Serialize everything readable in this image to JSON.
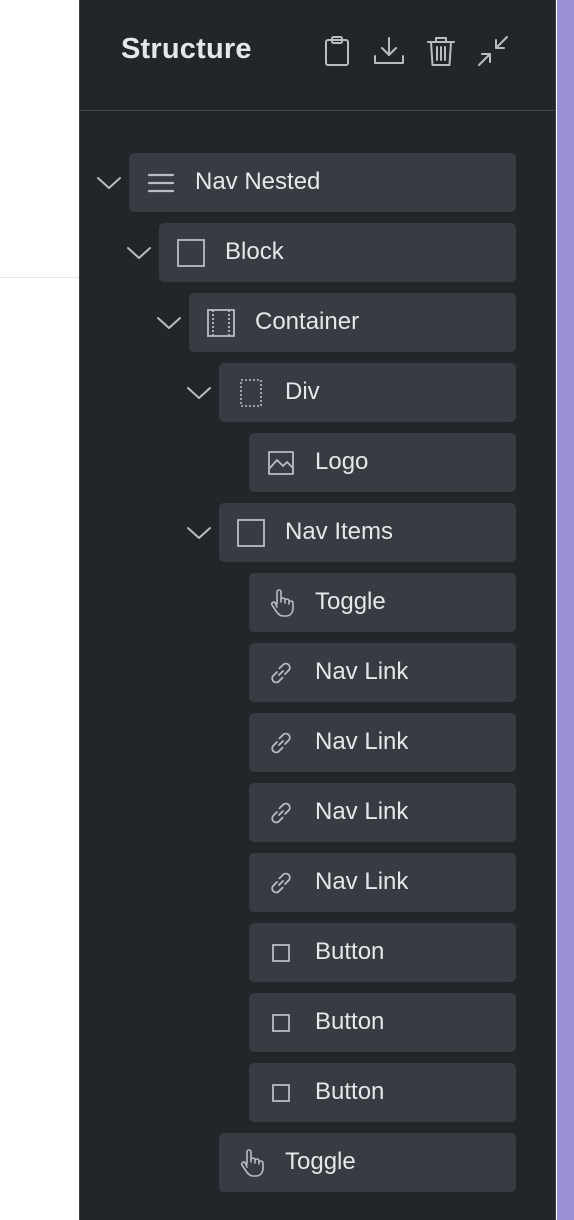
{
  "panel": {
    "title": "Structure",
    "header_icons": [
      "clipboard-icon",
      "download-icon",
      "trash-icon",
      "collapse-icon"
    ]
  },
  "tree": [
    {
      "label": "Nav Nested",
      "icon": "nav-menu-icon",
      "depth": 0,
      "expanded": true
    },
    {
      "label": "Block",
      "icon": "square-icon",
      "depth": 1,
      "expanded": true
    },
    {
      "label": "Container",
      "icon": "container-icon",
      "depth": 2,
      "expanded": true
    },
    {
      "label": "Div",
      "icon": "div-icon",
      "depth": 3,
      "expanded": true
    },
    {
      "label": "Logo",
      "icon": "image-icon",
      "depth": 4,
      "expanded": null
    },
    {
      "label": "Nav Items",
      "icon": "square-icon",
      "depth": 3,
      "expanded": true
    },
    {
      "label": "Toggle",
      "icon": "hand-pointer-icon",
      "depth": 4,
      "expanded": null
    },
    {
      "label": "Nav Link",
      "icon": "link-icon",
      "depth": 4,
      "expanded": null
    },
    {
      "label": "Nav Link",
      "icon": "link-icon",
      "depth": 4,
      "expanded": null
    },
    {
      "label": "Nav Link",
      "icon": "link-icon",
      "depth": 4,
      "expanded": null
    },
    {
      "label": "Nav Link",
      "icon": "link-icon",
      "depth": 4,
      "expanded": null
    },
    {
      "label": "Button",
      "icon": "small-square-icon",
      "depth": 4,
      "expanded": null
    },
    {
      "label": "Button",
      "icon": "small-square-icon",
      "depth": 4,
      "expanded": null
    },
    {
      "label": "Button",
      "icon": "small-square-icon",
      "depth": 4,
      "expanded": null
    },
    {
      "label": "Toggle",
      "icon": "hand-pointer-icon",
      "depth": 3,
      "expanded": null
    }
  ],
  "colors": {
    "panel_bg": "#22252a",
    "row_bg": "#373b42",
    "text": "#e6e7ea",
    "icon": "#b9bcc2",
    "accent": "#9b90d6"
  }
}
